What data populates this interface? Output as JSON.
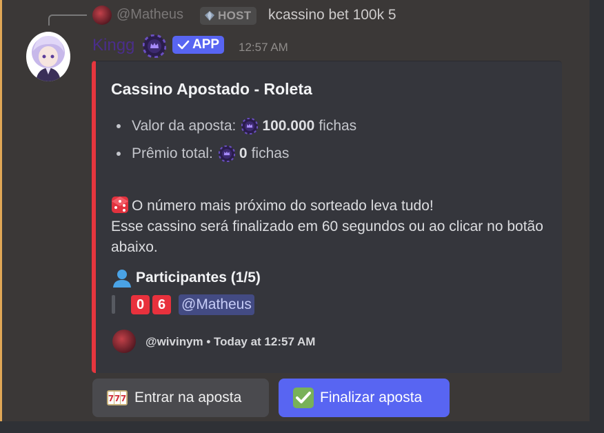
{
  "reply": {
    "username": "@Matheus",
    "tag": "HOST",
    "text": "kcassino bet 100k 5"
  },
  "message": {
    "username": "Kingg",
    "badge": "APP",
    "timestamp": "12:57 AM"
  },
  "embed": {
    "title": "Cassino Apostado - Roleta",
    "bet_label": "Valor da aposta:",
    "bet_value": "100.000",
    "bet_unit": "fichas",
    "prize_label": "Prêmio total:",
    "prize_value": "0",
    "prize_unit": "fichas",
    "description_line1": "O número mais próximo do sorteado leva tudo!",
    "description_line2": "Esse cassino será finalizado em 60 segundos ou ao clicar no botão abaixo.",
    "participants_title": "Participantes (1/5)",
    "participants": [
      {
        "digit1": "0",
        "digit2": "6",
        "mention": "@Matheus"
      }
    ],
    "footer": "@wivinym • Today at 12:57 AM"
  },
  "buttons": {
    "join_label": "Entrar na aposta",
    "finish_label": "Finalizar aposta"
  },
  "colors": {
    "accent_embed": "#e6363e",
    "app_badge": "#5865f2",
    "username": "#4a2e8a",
    "message_highlight_border": "#e0a756"
  }
}
